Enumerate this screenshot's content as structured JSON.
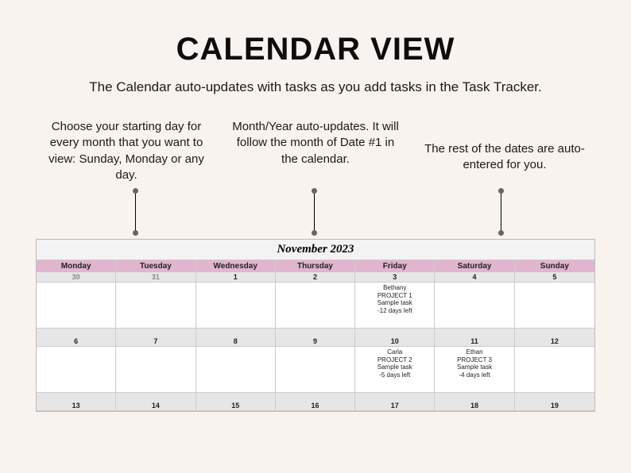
{
  "title": "CALENDAR VIEW",
  "subtitle": "The Calendar auto-updates with tasks as you add tasks in the Task Tracker.",
  "callouts": {
    "c1": "Choose your starting day for every month that you want to view: Sunday, Monday or any day.",
    "c2": "Month/Year auto-updates. It will follow the month of Date #1 in the calendar.",
    "c3": "The rest of the dates are auto-entered for you."
  },
  "calendar": {
    "month_title": "November 2023",
    "day_headers": [
      "Monday",
      "Tuesday",
      "Wednesday",
      "Thursday",
      "Friday",
      "Saturday",
      "Sunday"
    ],
    "weeks": [
      {
        "dates": [
          "30",
          "31",
          "1",
          "2",
          "3",
          "4",
          "5"
        ],
        "dim": [
          true,
          true,
          false,
          false,
          false,
          false,
          false
        ],
        "content": [
          [],
          [],
          [],
          [],
          [
            "Bethany",
            "PROJECT 1",
            "Sample task",
            "-12 days left"
          ],
          [],
          []
        ]
      },
      {
        "dates": [
          "6",
          "7",
          "8",
          "9",
          "10",
          "11",
          "12"
        ],
        "dim": [
          false,
          false,
          false,
          false,
          false,
          false,
          false
        ],
        "content": [
          [],
          [],
          [],
          [],
          [
            "Carla",
            "PROJECT 2",
            "Sample task",
            "-5 days left"
          ],
          [
            "Ethan",
            "PROJECT 3",
            "Sample task",
            "-4 days left"
          ],
          []
        ]
      },
      {
        "dates": [
          "13",
          "14",
          "15",
          "16",
          "17",
          "18",
          "19"
        ],
        "dim": [
          false,
          false,
          false,
          false,
          false,
          false,
          false
        ],
        "content": []
      }
    ]
  }
}
